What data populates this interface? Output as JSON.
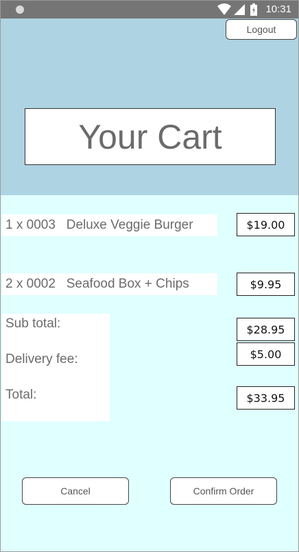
{
  "status_bar": {
    "time": "10:31",
    "icons": [
      "wifi-icon",
      "signal-icon",
      "battery-icon"
    ]
  },
  "header": {
    "logout_label": "Logout",
    "title": "Your Cart",
    "background_color": "#aed3e3"
  },
  "cart": {
    "items": [
      {
        "description": "1 x 0003   Deluxe Veggie Burger",
        "price": "$19.00"
      },
      {
        "description": "2 x 0002   Seafood Box + Chips",
        "price": "$9.95"
      }
    ]
  },
  "summary": {
    "subtotal_label": "Sub total:",
    "subtotal_value": "$28.95",
    "delivery_label": "Delivery fee:",
    "delivery_value": "$5.00",
    "total_label": "Total:",
    "total_value": "$33.95"
  },
  "actions": {
    "cancel_label": "Cancel",
    "confirm_label": "Confirm Order"
  },
  "colors": {
    "content_background": "#e0ffff",
    "status_bar": "#757575"
  }
}
